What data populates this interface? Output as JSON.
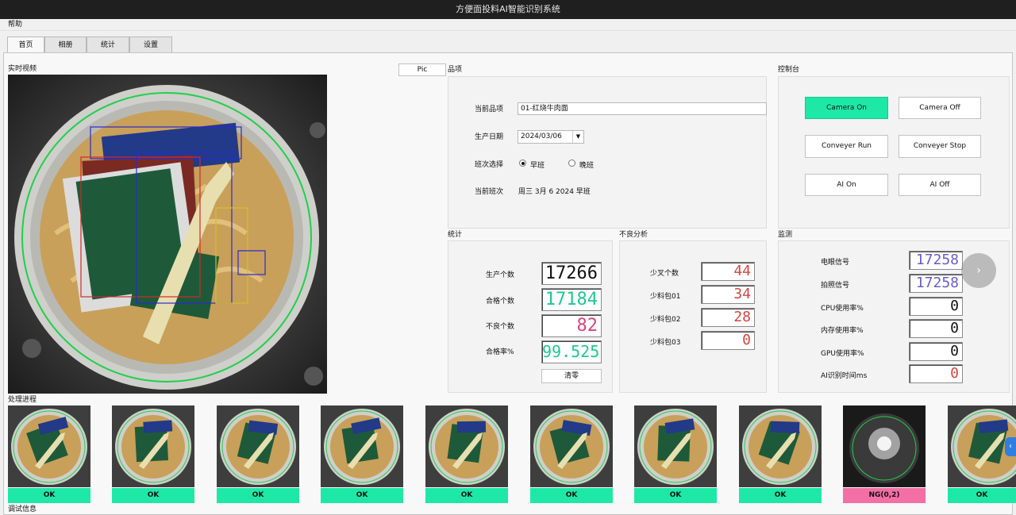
{
  "window": {
    "title": "方便面投料AI智能识别系统"
  },
  "menu": {
    "help": "帮助"
  },
  "tabs": [
    "首页",
    "相册",
    "统计",
    "设置"
  ],
  "video": {
    "label": "实时视频",
    "pic_button": "Pic"
  },
  "product": {
    "label": "品项",
    "current_item_label": "当前品项",
    "current_item_value": "01-红烧牛肉面",
    "date_label": "生产日期",
    "date_value": "2024/03/06",
    "shift_label": "班次选择",
    "shift_options": [
      "早班",
      "晚班"
    ],
    "shift_selected": "早班",
    "current_shift_label": "当前班次",
    "current_shift_value": "周三 3月 6 2024 早班"
  },
  "console": {
    "label": "控制台",
    "buttons": [
      "Camera On",
      "Camera Off",
      "Conveyer Run",
      "Conveyer Stop",
      "AI On",
      "AI Off"
    ]
  },
  "stats": {
    "label": "统计",
    "rows": [
      {
        "label": "生产个数",
        "value": "17266",
        "color": "#111111"
      },
      {
        "label": "合格个数",
        "value": "17184",
        "color": "#1ec98e"
      },
      {
        "label": "不良个数",
        "value": "82",
        "color": "#d9447a"
      },
      {
        "label": "合格率%",
        "value": "99.525",
        "color": "#1ec98e"
      }
    ],
    "reset_button": "清零"
  },
  "defects": {
    "label": "不良分析",
    "rows": [
      {
        "label": "少叉个数",
        "value": "44"
      },
      {
        "label": "少料包01",
        "value": "34"
      },
      {
        "label": "少料包02",
        "value": "28"
      },
      {
        "label": "少料包03",
        "value": "0"
      }
    ],
    "color": "#d4463f"
  },
  "monitor": {
    "label": "监测",
    "rows": [
      {
        "label": "电眼信号",
        "value": "17258",
        "color": "#6a5bd0"
      },
      {
        "label": "拍照信号",
        "value": "17258",
        "color": "#6a5bd0"
      },
      {
        "label": "CPU使用率%",
        "value": "0",
        "color": "#111111"
      },
      {
        "label": "内存使用率%",
        "value": "0",
        "color": "#111111"
      },
      {
        "label": "GPU使用率%",
        "value": "0",
        "color": "#111111"
      },
      {
        "label": "AI识别时间ms",
        "value": "0",
        "color": "#d4463f"
      }
    ]
  },
  "process": {
    "label": "处理进程",
    "results": [
      "OK",
      "OK",
      "OK",
      "OK",
      "OK",
      "OK",
      "OK",
      "OK",
      "NG(0,2)",
      "OK"
    ],
    "ok_color": "#1ee8a6",
    "ng_color": "#f36fa6"
  },
  "debug": {
    "label": "调试信息"
  }
}
